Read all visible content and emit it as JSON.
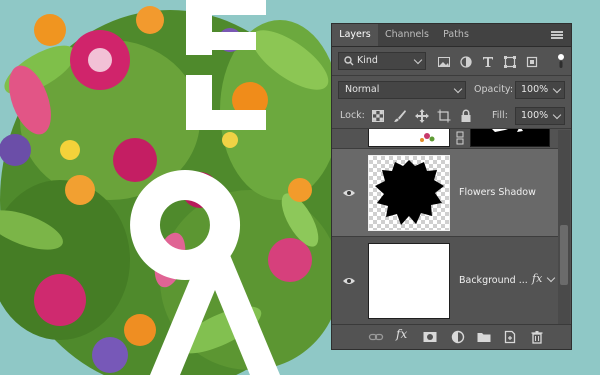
{
  "canvas": {
    "background_color": "#8fc8c6",
    "letters_color": "#ffffff"
  },
  "panel": {
    "tabs": [
      {
        "label": "Layers",
        "active": true
      },
      {
        "label": "Channels",
        "active": false
      },
      {
        "label": "Paths",
        "active": false
      }
    ],
    "filter": {
      "kind_label": "Kind",
      "icons": [
        "image-filter-icon",
        "adjustment-filter-icon",
        "type-filter-icon",
        "shape-filter-icon",
        "smart-object-filter-icon",
        "filter-toggle-icon"
      ]
    },
    "blend": {
      "mode": "Normal",
      "opacity_label": "Opacity:",
      "opacity_value": "100%"
    },
    "lock": {
      "label": "Lock:",
      "icons": [
        "lock-transparent-pixels-icon",
        "lock-image-pixels-icon",
        "lock-position-icon",
        "lock-artboard-icon",
        "lock-all-icon"
      ],
      "fill_label": "Fill:",
      "fill_value": "100%"
    },
    "layers": [
      {
        "name": "",
        "visible": false,
        "selected": false,
        "partial": true
      },
      {
        "name": "Flowers Shadow",
        "visible": true,
        "selected": true
      },
      {
        "name": "Background ...",
        "visible": true,
        "selected": false,
        "fx": "fx"
      }
    ],
    "bottom_icons": [
      "link-layers-icon",
      "add-style-icon",
      "add-mask-icon",
      "adjustment-layer-icon",
      "new-group-icon",
      "new-layer-icon",
      "delete-icon"
    ]
  }
}
